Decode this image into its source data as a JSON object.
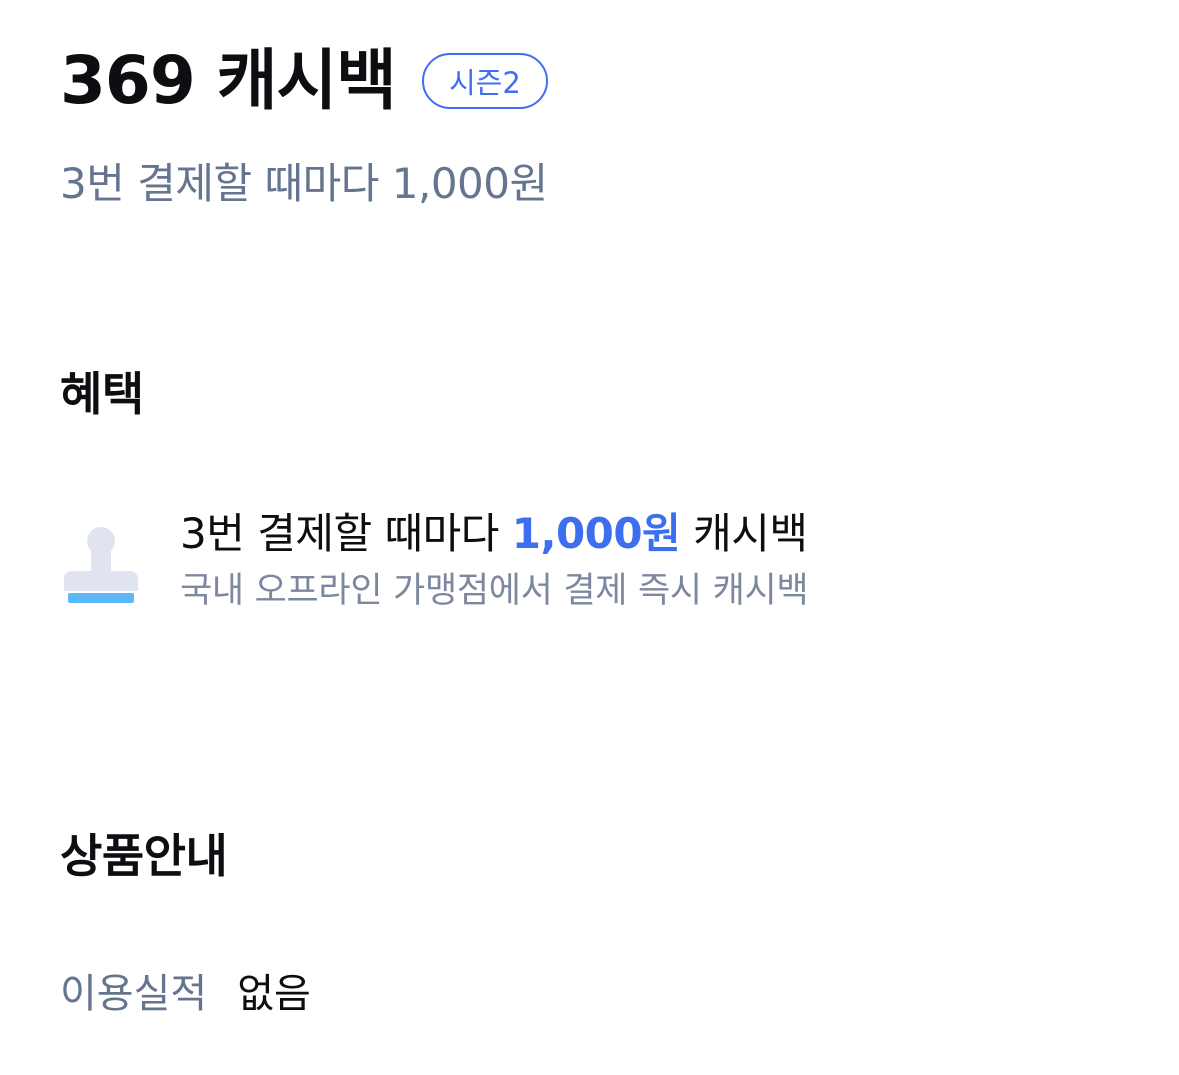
{
  "header": {
    "title": "369 캐시백",
    "season_badge": "시즌2",
    "subtitle": "3번 결제할 때마다 1,000원"
  },
  "benefits": {
    "heading": "혜택",
    "items": [
      {
        "icon": "stamp-icon",
        "title_prefix": "3번 결제할 때마다",
        "title_amount": "1,000원",
        "title_suffix": "캐시백",
        "description": "국내 오프라인 가맹점에서 결제 즉시 캐시백"
      }
    ]
  },
  "product_info": {
    "heading": "상품안내",
    "rows": [
      {
        "label": "이용실적",
        "value": "없음"
      }
    ]
  },
  "colors": {
    "accent": "#3f6ef0",
    "subtext": "#66758f",
    "stamp_body": "#dfe4f0",
    "stamp_base": "#5bb8fb"
  }
}
